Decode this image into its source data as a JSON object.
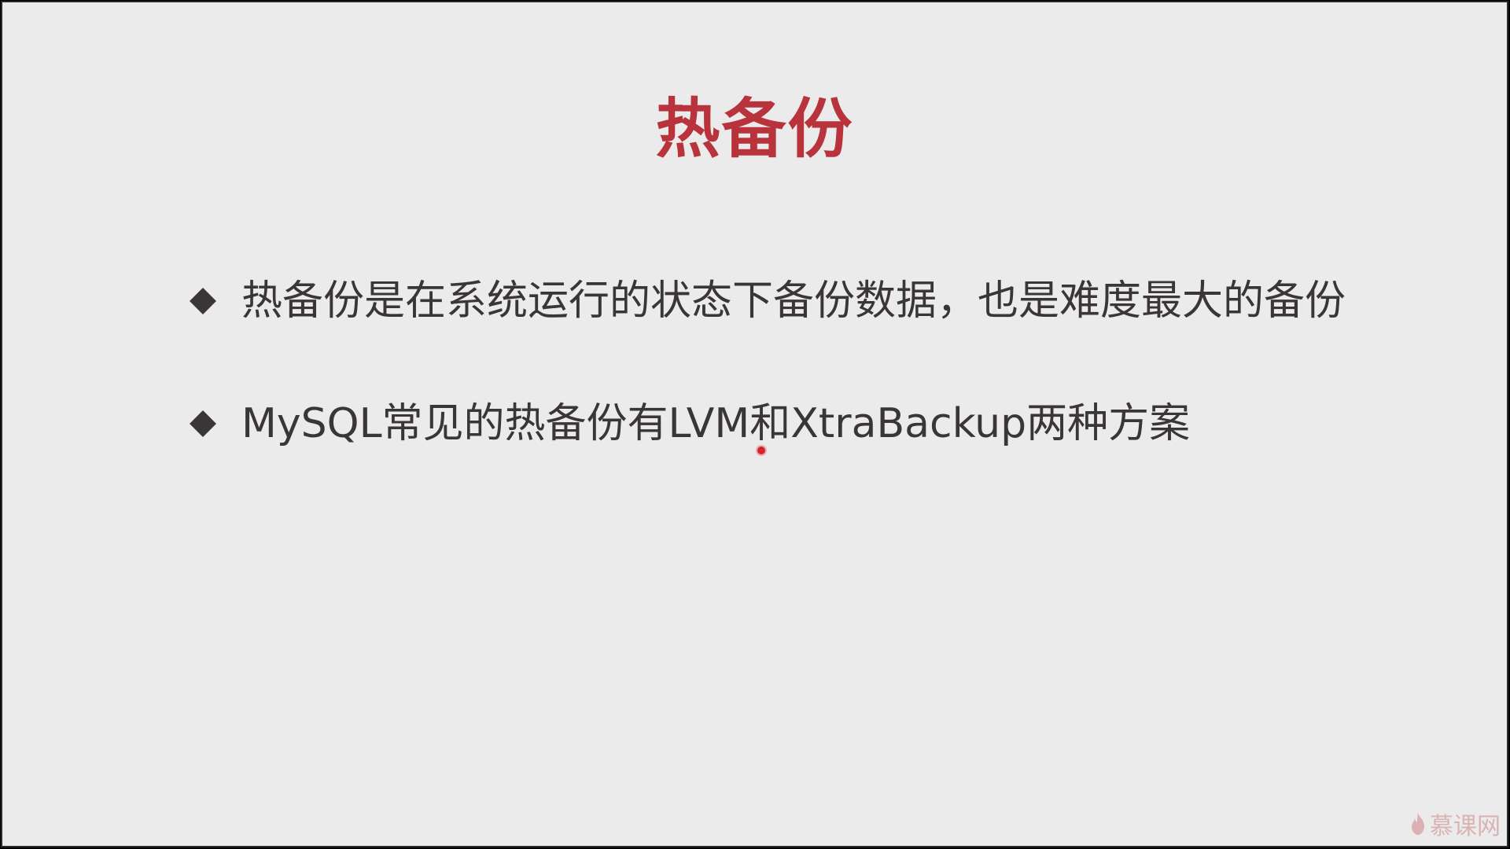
{
  "slide": {
    "title": "热备份",
    "bullets": [
      {
        "text": "热备份是在系统运行的状态下备份数据，也是难度最大的备份"
      },
      {
        "text": "MySQL常见的热备份有LVM和XtraBackup两种方案"
      }
    ]
  },
  "watermark": {
    "text": "慕课网",
    "icon": "flame-icon"
  },
  "colors": {
    "background": "#ecebeb",
    "title": "#b8333b",
    "body_text": "#3a3638",
    "pointer": "#d8232a",
    "watermark": "#d9a9ab"
  }
}
